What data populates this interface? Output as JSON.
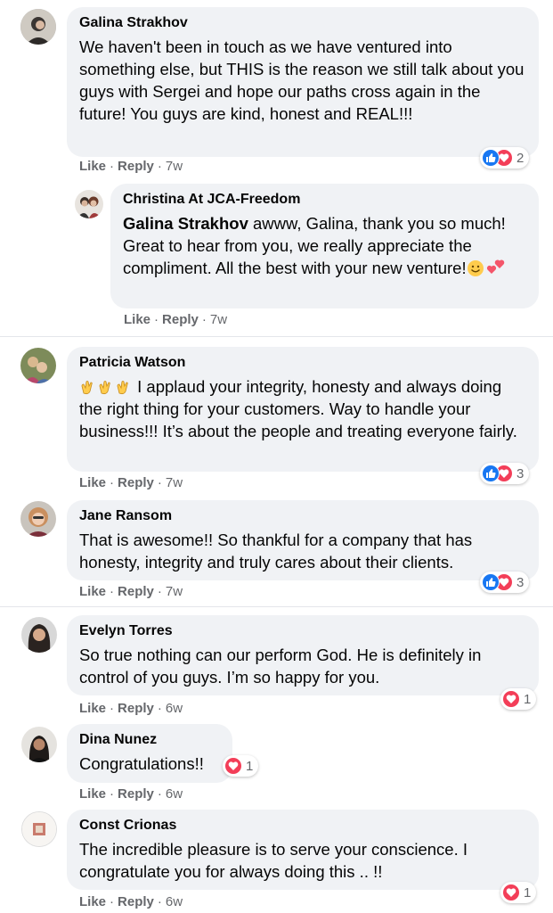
{
  "comments": [
    {
      "author": "Galina Strakhov",
      "text": "We haven't been in touch as we have ventured into something else, but THIS is the reason we still talk about you guys with Sergei and hope our paths cross again in the future! You guys are kind, honest and REAL!!!",
      "like": "Like",
      "reply": "Reply",
      "time": "7w",
      "reaction_count": "2",
      "reactions": [
        "like-icon",
        "love-icon"
      ]
    },
    {
      "author": "Christina At JCA-Freedom",
      "mention": "Galina Strakhov",
      "text": " awww, Galina, thank you so much! Great to hear from you, we really appreciate the compliment. All the best with your new venture!",
      "emojis": [
        "smiling-face-icon",
        "two-hearts-icon"
      ],
      "like": "Like",
      "reply": "Reply",
      "time": "7w"
    },
    {
      "author": "Patricia Watson",
      "emojis": [
        "clapping-hands-icon",
        "clapping-hands-icon",
        "clapping-hands-icon"
      ],
      "text": " I applaud your integrity, honesty and always doing the right thing for your customers. Way to handle your business!!! It’s about the people and treating everyone fairly.",
      "like": "Like",
      "reply": "Reply",
      "time": "7w",
      "reaction_count": "3",
      "reactions": [
        "like-icon",
        "love-icon"
      ]
    },
    {
      "author": "Jane Ransom",
      "text": "That is awesome!! So thankful for a company that has honesty, integrity and truly cares about their clients.",
      "like": "Like",
      "reply": "Reply",
      "time": "7w",
      "reaction_count": "3",
      "reactions": [
        "like-icon",
        "love-icon"
      ]
    },
    {
      "author": "Evelyn Torres",
      "text": "So true nothing can our perform God. He is definitely in control of you guys. I’m so happy for you.",
      "like": "Like",
      "reply": "Reply",
      "time": "6w",
      "reaction_count": "1",
      "reactions": [
        "love-icon"
      ]
    },
    {
      "author": "Dina Nunez",
      "text": "Congratulations!!",
      "like": "Like",
      "reply": "Reply",
      "time": "6w",
      "reaction_count": "1",
      "reactions": [
        "love-icon"
      ]
    },
    {
      "author": "Const Crionas",
      "text": "The incredible pleasure is to serve your conscience. I congratulate you for always doing this .. !!",
      "like": "Like",
      "reply": "Reply",
      "time": "6w",
      "reaction_count": "1",
      "reactions": [
        "love-icon"
      ]
    }
  ],
  "colors": {
    "bubble": "#f0f2f5",
    "meta_text": "#65676b",
    "like_blue": "#1877f2",
    "love_red": "#f33e58"
  }
}
